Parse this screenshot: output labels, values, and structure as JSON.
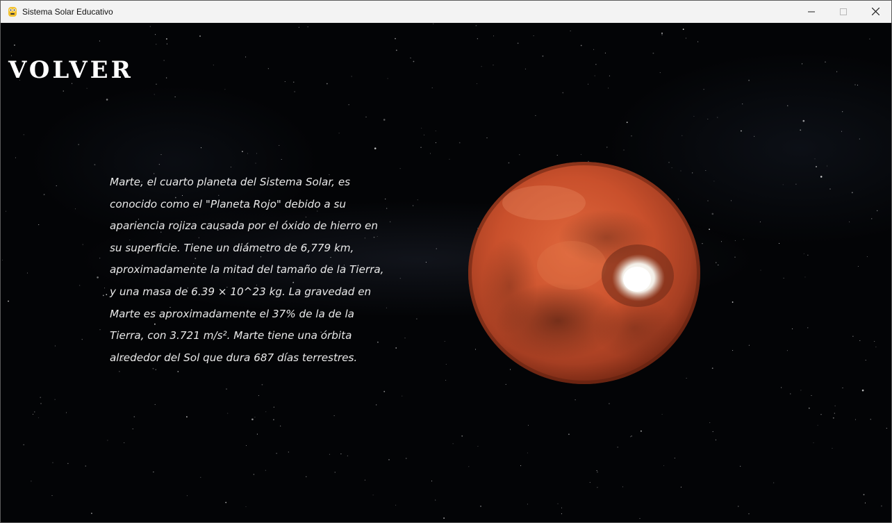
{
  "window": {
    "title": "Sistema Solar Educativo",
    "app_icon": "python-icon",
    "controls": [
      "minimize-icon",
      "maximize-icon",
      "close-icon"
    ]
  },
  "page": {
    "back_label": "VOLVER",
    "description": "Marte, el cuarto planeta del Sistema Solar, es conocido como el \"Planeta Rojo\" debido a su apariencia rojiza causada por el óxido de hierro en su superficie. Tiene un diámetro de 6,779 km, aproximadamente la mitad del tamaño de la Tierra, y una masa de 6.39 × 10^23 kg. La gravedad en Marte es aproximadamente el 37% de la de la Tierra, con 3.721 m/s². Marte tiene una órbita alrededor del Sol que dura 687 días terrestres.",
    "planet": "Marte"
  },
  "colors": {
    "background": "#030406",
    "text": "#e9e9e9",
    "planet_base": "#c9502c",
    "titlebar": "#f3f3f3"
  }
}
